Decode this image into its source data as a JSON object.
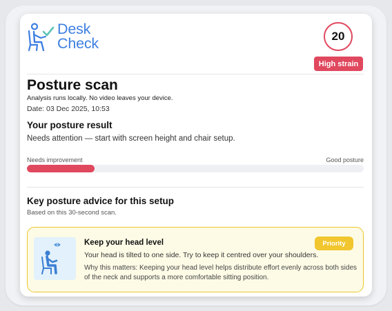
{
  "brand": {
    "line1": "Desk",
    "line2": "Check",
    "color": "#3d7fe0"
  },
  "score": {
    "value": "20",
    "badge": "High strain",
    "color": "#e0485e"
  },
  "scan": {
    "title": "Posture scan",
    "privacy_note": "Analysis runs locally. No video leaves your device.",
    "date": "Date: 03 Dec 2025, 10:53"
  },
  "result": {
    "heading": "Your posture result",
    "summary": "Needs attention — start with screen height and chair setup.",
    "scale_low": "Needs improvement",
    "scale_high": "Good posture",
    "progress": 0.2
  },
  "advice": {
    "heading": "Key posture advice for this setup",
    "subheading": "Based on this 30-second scan.",
    "tips": [
      {
        "title": "Keep your head level",
        "badge": "Priority",
        "body": "Your head is tilted to one side. Try to keep it centred over your shoulders.",
        "why": "Why this matters: Keeping your head level helps distribute effort evenly across both sides of the neck and supports a more comfortable sitting position.",
        "icon": "head-tilt-sitting-person-icon",
        "accent": "#e9c62a"
      }
    ]
  }
}
